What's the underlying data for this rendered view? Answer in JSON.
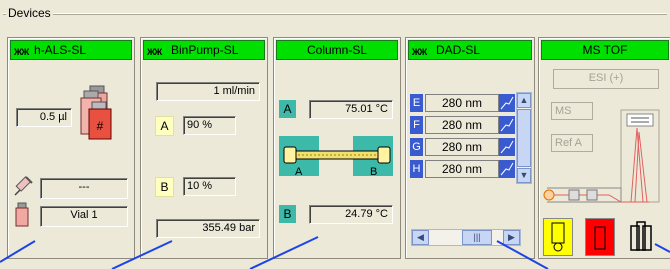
{
  "group": {
    "title": "Devices"
  },
  "modules": {
    "als": {
      "title": "h-ALS-SL",
      "logo": "ЖЖ",
      "volume": "0.5 µl",
      "field_blank": "---",
      "vial": "Vial 1",
      "icons": [
        "vial-tray-icon",
        "syringe-icon",
        "vial-icon"
      ]
    },
    "pump": {
      "title": "BinPump-SL",
      "logo": "ЖЖ",
      "flow": "1 ml/min",
      "a_label": "A",
      "a_value": "90 %",
      "b_label": "B",
      "b_value": "10 %",
      "pressure": "355.49 bar"
    },
    "column": {
      "title": "Column-SL",
      "a_label": "A",
      "a_temp": "75.01 °C",
      "b_label": "B",
      "b_temp": "24.79 °C",
      "col_a": "A",
      "col_b": "B"
    },
    "dad": {
      "title": "DAD-SL",
      "logo": "ЖЖ",
      "rows": [
        {
          "letter": "E",
          "value": "280 nm"
        },
        {
          "letter": "F",
          "value": "280 nm"
        },
        {
          "letter": "G",
          "value": "280 nm"
        },
        {
          "letter": "H",
          "value": "280 nm"
        }
      ]
    },
    "ms": {
      "title": "MS TOF",
      "source": "ESI (+)",
      "mode": "MS",
      "ref": "Ref A",
      "status_colors": {
        "yellow": "#ffff00",
        "red": "#ff0000"
      }
    }
  },
  "colors": {
    "header_green": "#00e000",
    "teal": "#3cb9a8",
    "dad_blue": "#3a5bd0",
    "pointer_blue": "#1e44e6"
  }
}
